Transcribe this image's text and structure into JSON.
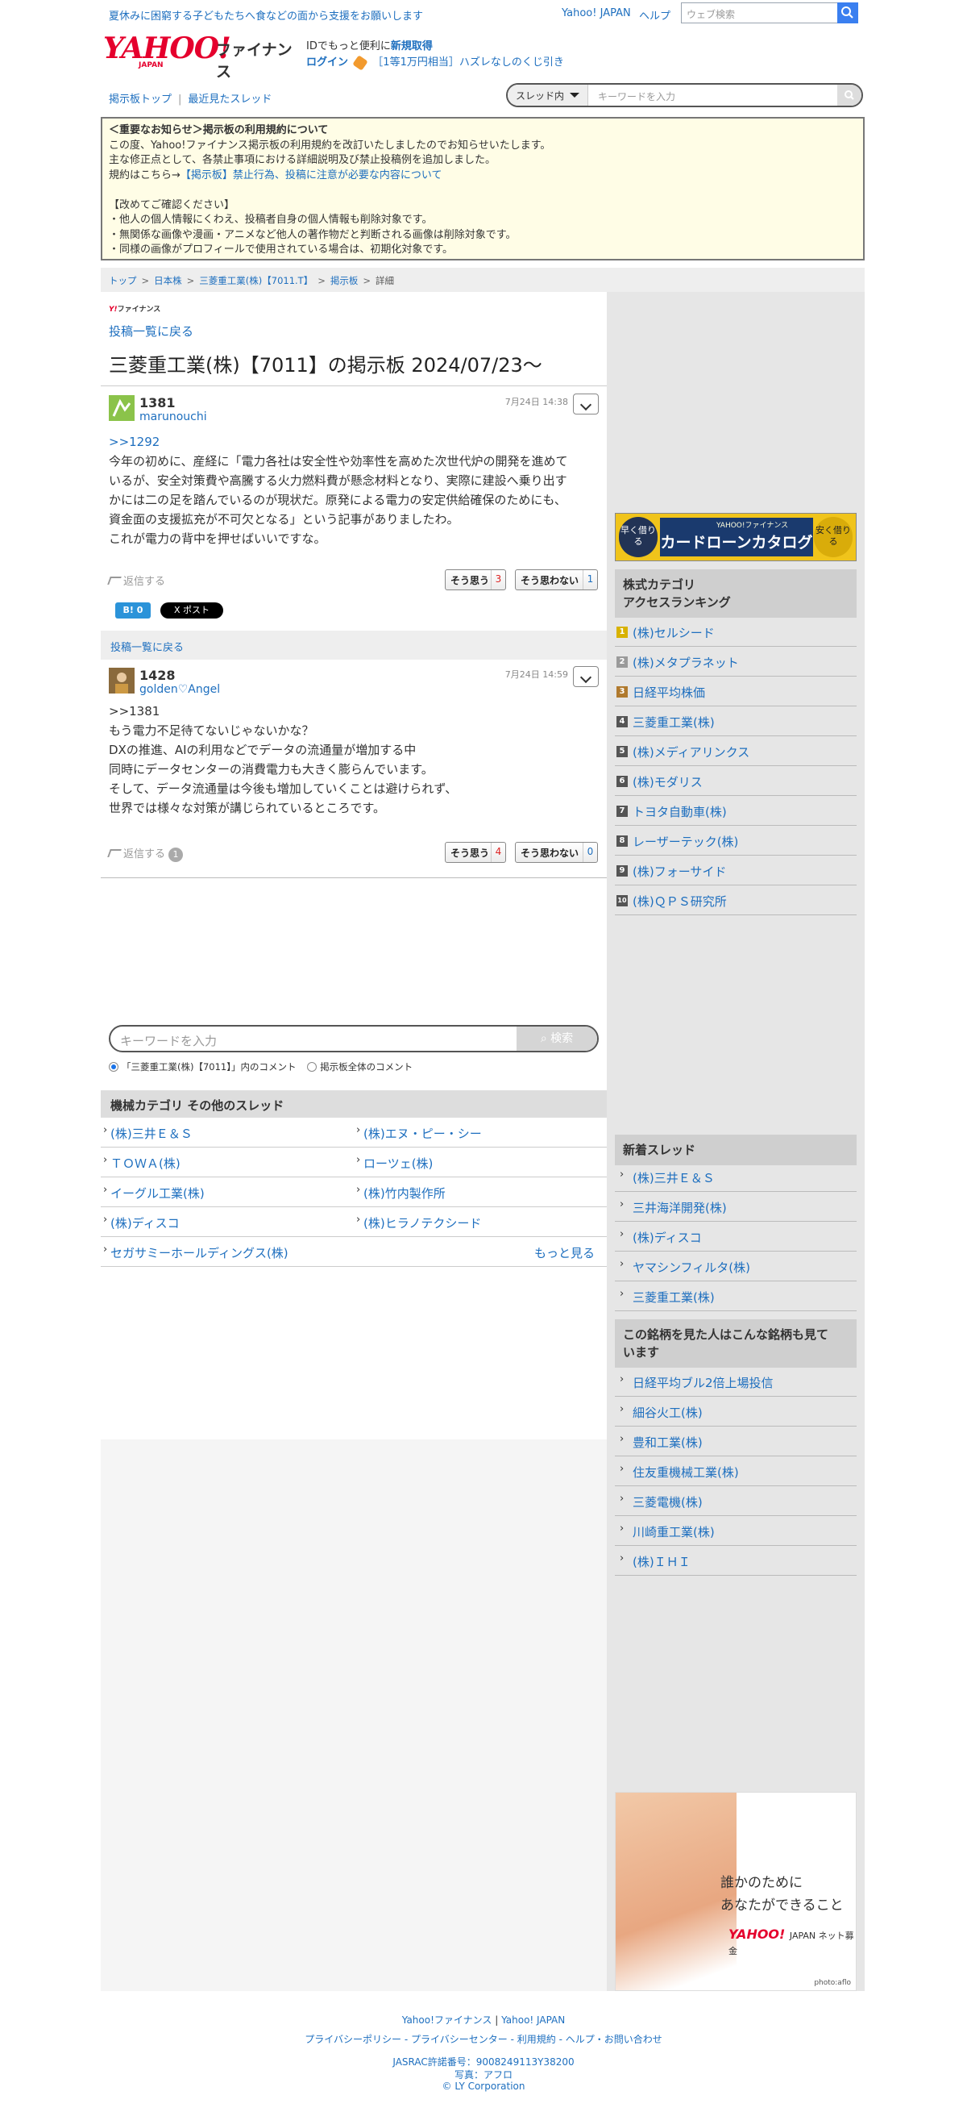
{
  "topbar": {
    "notice": "夏休みに困窮する子どもたちへ食などの面から支援をお願いします",
    "yahoo_japan": "Yahoo! JAPAN",
    "help": "ヘルプ",
    "search_placeholder": "ウェブ検索"
  },
  "header": {
    "logo_text": "YAHOO!",
    "logo_sub": "JAPAN",
    "service": "ファイナンス",
    "id_prefix": "IDでもっと便利に",
    "id_link": "新規取得",
    "login": "ログイン",
    "lottery": "［1等1万円相当］ハズレなしのくじ引き"
  },
  "subnav": {
    "board_top": "掲示板トップ",
    "recent": "最近見たスレッド",
    "scope": "スレッド内",
    "keyword_placeholder": "キーワードを入力"
  },
  "rules": {
    "title": "＜重要なお知らせ＞掲示板の利用規約について",
    "line1": "この度、Yahoo!ファイナンス掲示板の利用規約を改訂いたしましたのでお知らせいたします。",
    "line2": "主な修正点として、各禁止事項における詳細説明及び禁止投稿例を追加しました。",
    "line3_prefix": "規約はこちら→",
    "line3_link": "【掲示板】禁止行為、投稿に注意が必要な内容について",
    "confirm": "【改めてご確認ください】",
    "b1": "・他人の個人情報にくわえ、投稿者自身の個人情報も削除対象です。",
    "b2": "・無関係な画像や漫画・アニメなど他人の著作物だと判断される画像は削除対象です。",
    "b3": "・同様の画像がプロフィールで使用されている場合は、初期化対象です。"
  },
  "breadcrumb": {
    "top": "トップ",
    "jp_stocks": "日本株",
    "company": "三菱重工業(株)【7011.T】",
    "board": "掲示板",
    "current": "詳細"
  },
  "main": {
    "small_logo": "Y!",
    "small_logo_sub": "ファイナンス",
    "back": "投稿一覧に戻る",
    "title": "三菱重工業(株)【7011】の掲示板 2024/07/23〜"
  },
  "posts": [
    {
      "number": "1381",
      "user": "marunouchi",
      "date": "7月24日 14:38",
      "anchor": ">>1292",
      "lines": [
        "今年の初めに、産経に「電力各社は安全性や効率性を高めた次世代炉の開発を進めて",
        "いるが、安全対策費や高騰する火力燃料費が懸念材料となり、実際に建設へ乗り出す",
        "かには二の足を踏んでいるのが現状だ。原発による電力の安定供給確保のためにも、",
        "資金面の支援拡充が不可欠となる」という記事がありましたわ。",
        "これが電力の背中を押せばいいですな。"
      ],
      "reply": "返信する",
      "agree": "そう思う",
      "agree_count": "3",
      "disagree": "そう思わない",
      "disagree_count": "1",
      "hatena": "B! 0",
      "xpost": "X ポスト"
    },
    {
      "number": "1428",
      "user": "golden♡Angel",
      "date": "7月24日 14:59",
      "lines": [
        ">>1381",
        "もう電力不足待てないじゃないかな？",
        "DXの推進、AIの利用などでデータの流通量が増加する中",
        "同時にデータセンターの消費電力も大きく膨らんでいます。",
        "そして、データ流通量は今後も増加していくことは避けられず、",
        "世界では様々な対策が講じられているところです。"
      ],
      "reply": "返信する",
      "reply_count": "1",
      "agree": "そう思う",
      "agree_count": "4",
      "disagree": "そう思わない",
      "disagree_count": "0"
    }
  ],
  "backbar": "投稿一覧に戻る",
  "search": {
    "placeholder": "キーワードを入力",
    "button": "検索",
    "option1": "「三菱重工業(株)【7011】」内のコメント",
    "option2": "掲示板全体のコメント"
  },
  "category": {
    "title": "機械カテゴリ その他のスレッド",
    "items": [
      "(株)三井Ｅ＆Ｓ",
      "(株)エヌ・ピー・シー",
      "ＴＯＷＡ(株)",
      "ローツェ(株)",
      "イーグル工業(株)",
      "(株)竹内製作所",
      "(株)ディスコ",
      "(株)ヒラノテクシード",
      "セガサミーホールディングス(株)"
    ],
    "more": "もっと見る"
  },
  "ad_banner": {
    "left": "早く借りる",
    "brand": "YAHOO!ファイナンス",
    "center": "カードローンカタログ",
    "right": "安く借りる"
  },
  "ranking": {
    "title1": "株式カテゴリ",
    "title2": "アクセスランキング",
    "items": [
      {
        "rank": "1",
        "name": "(株)セルシード"
      },
      {
        "rank": "2",
        "name": "(株)メタプラネット"
      },
      {
        "rank": "3",
        "name": "日経平均株価"
      },
      {
        "rank": "4",
        "name": "三菱重工業(株)"
      },
      {
        "rank": "5",
        "name": "(株)メディアリンクス"
      },
      {
        "rank": "6",
        "name": "(株)モダリス"
      },
      {
        "rank": "7",
        "name": "トヨタ自動車(株)"
      },
      {
        "rank": "8",
        "name": "レーザーテック(株)"
      },
      {
        "rank": "9",
        "name": "(株)フォーサイド"
      },
      {
        "rank": "10",
        "name": "(株)ＱＰＳ研究所"
      }
    ]
  },
  "new_threads": {
    "title": "新着スレッド",
    "items": [
      "(株)三井Ｅ＆Ｓ",
      "三井海洋開発(株)",
      "(株)ディスコ",
      "ヤマシンフィルタ(株)",
      "三菱重工業(株)"
    ]
  },
  "also_viewed": {
    "title1": "この銘柄を見た人はこんな銘柄も見て",
    "title2": "います",
    "items": [
      "日経平均ブル2倍上場投信",
      "細谷火工(株)",
      "豊和工業(株)",
      "住友重機械工業(株)",
      "三菱電機(株)",
      "川崎重工業(株)",
      "(株)ＩＨＩ"
    ]
  },
  "photo_ad": {
    "line1": "誰かのために",
    "line2": "あなたができること",
    "brand": "YAHOO!",
    "brand_sub": "JAPAN ネット募金",
    "credit": "photo:aflo"
  },
  "footer": {
    "finance": "Yahoo!ファイナンス",
    "yj": "Yahoo! JAPAN",
    "privacy_policy": "プライバシーポリシー",
    "privacy_center": "プライバシーセンター",
    "terms": "利用規約",
    "help": "ヘルプ・お問い合わせ",
    "jasrac": "JASRAC許諾番号：9008249113Y38200",
    "photo": "写真：アフロ",
    "copyright": "© LY Corporation"
  },
  "colors": {
    "link": "#1e6fbf",
    "brand_red": "#e5002d",
    "notice_bg": "#fffde6",
    "sidebar_bg": "#e6e6e6"
  }
}
